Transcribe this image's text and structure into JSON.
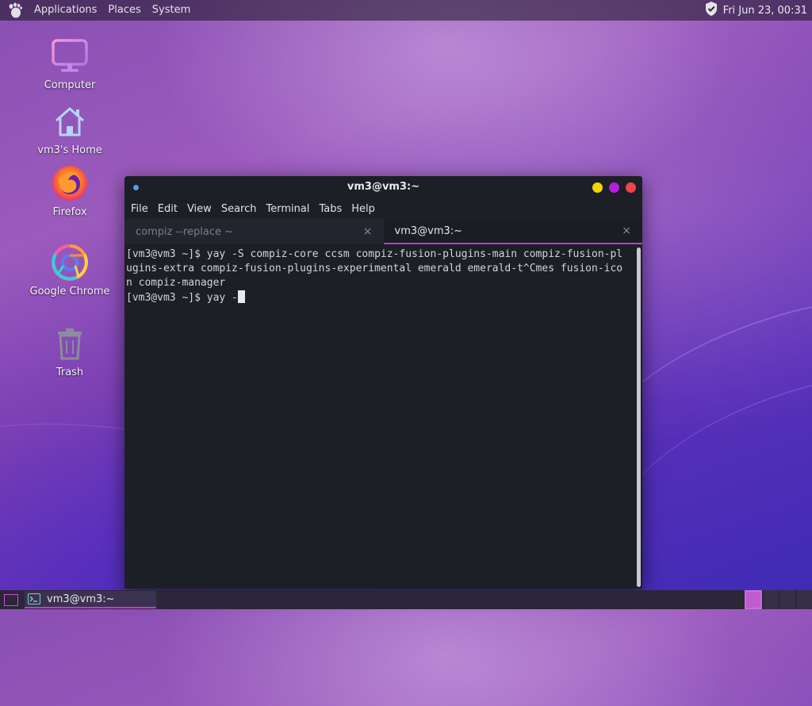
{
  "top_panel": {
    "menus": [
      "Applications",
      "Places",
      "System"
    ],
    "clock": "Fri Jun 23, 00:31",
    "icons": [
      "gnome-foot-icon",
      "shield-check-icon"
    ]
  },
  "desktop_icons": [
    {
      "label": "Computer",
      "icon": "computer-icon"
    },
    {
      "label": "vm3's Home",
      "icon": "home-folder-icon"
    },
    {
      "label": "Firefox",
      "icon": "firefox-icon"
    },
    {
      "label": "Google Chrome",
      "icon": "chrome-icon"
    },
    {
      "label": "Trash",
      "icon": "trash-icon"
    }
  ],
  "terminal": {
    "title": "vm3@vm3:~",
    "menu": [
      "File",
      "Edit",
      "View",
      "Search",
      "Terminal",
      "Tabs",
      "Help"
    ],
    "tabs": [
      {
        "label": "compiz --replace ~",
        "active": false
      },
      {
        "label": "vm3@vm3:~",
        "active": true
      }
    ],
    "tab_close": "×",
    "lines": [
      "[vm3@vm3 ~]$ yay -S compiz-core ccsm compiz-fusion-plugins-main compiz-fusion-pl",
      "ugins-extra compiz-fusion-plugins-experimental emerald emerald-t^Cmes fusion-ico",
      "n compiz-manager",
      "[vm3@vm3 ~]$ yay -"
    ],
    "window_button_colors": {
      "minimize": "#f2d600",
      "maximize": "#b51fe0",
      "close": "#f0434a"
    }
  },
  "taskbar": {
    "items": [
      {
        "label": "vm3@vm3:~",
        "icon": "terminal-icon"
      }
    ],
    "accent": "#c23ad8"
  }
}
